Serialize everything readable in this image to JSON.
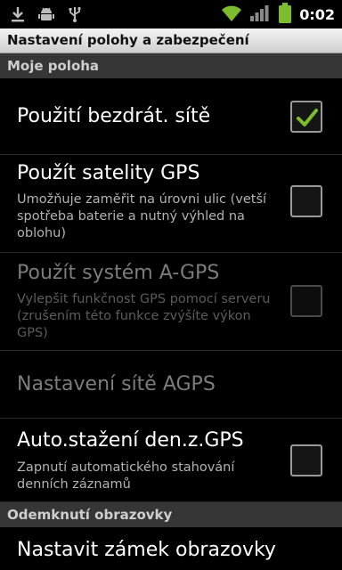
{
  "status_bar": {
    "time": "0:02",
    "icons": [
      "download-icon",
      "android-icon",
      "usb-icon",
      "wifi-icon",
      "signal-icon",
      "battery-icon"
    ],
    "accent_color": "#7dbd2d"
  },
  "title_bar": {
    "title": "Nastavení polohy a zabezpečení"
  },
  "categories": [
    {
      "label": "Moje poloha"
    },
    {
      "label": "Odemknutí obrazovky"
    }
  ],
  "settings": [
    {
      "title": "Použití bezdrát. sítě",
      "summary": "",
      "checked": true,
      "enabled": true
    },
    {
      "title": "Použít satelity GPS",
      "summary": "Umožňuje zaměřit na úrovni ulic (vetší spotřeba baterie a nutný výhled na oblohu)",
      "checked": false,
      "enabled": true
    },
    {
      "title": "Použít systém A-GPS",
      "summary": "Vylepšit funkčnost GPS pomocí serveru (zrušením této funkce zvýšíte výkon GPS)",
      "checked": false,
      "enabled": false
    },
    {
      "title": "Nastavení sítě AGPS",
      "summary": "",
      "enabled": false
    },
    {
      "title": "Auto.stažení den.z.GPS",
      "summary": "Zapnutí automatického stahování denních záznamů",
      "checked": false,
      "enabled": true
    },
    {
      "title": "Nastavit zámek obrazovky",
      "summary": "",
      "enabled": true
    }
  ]
}
